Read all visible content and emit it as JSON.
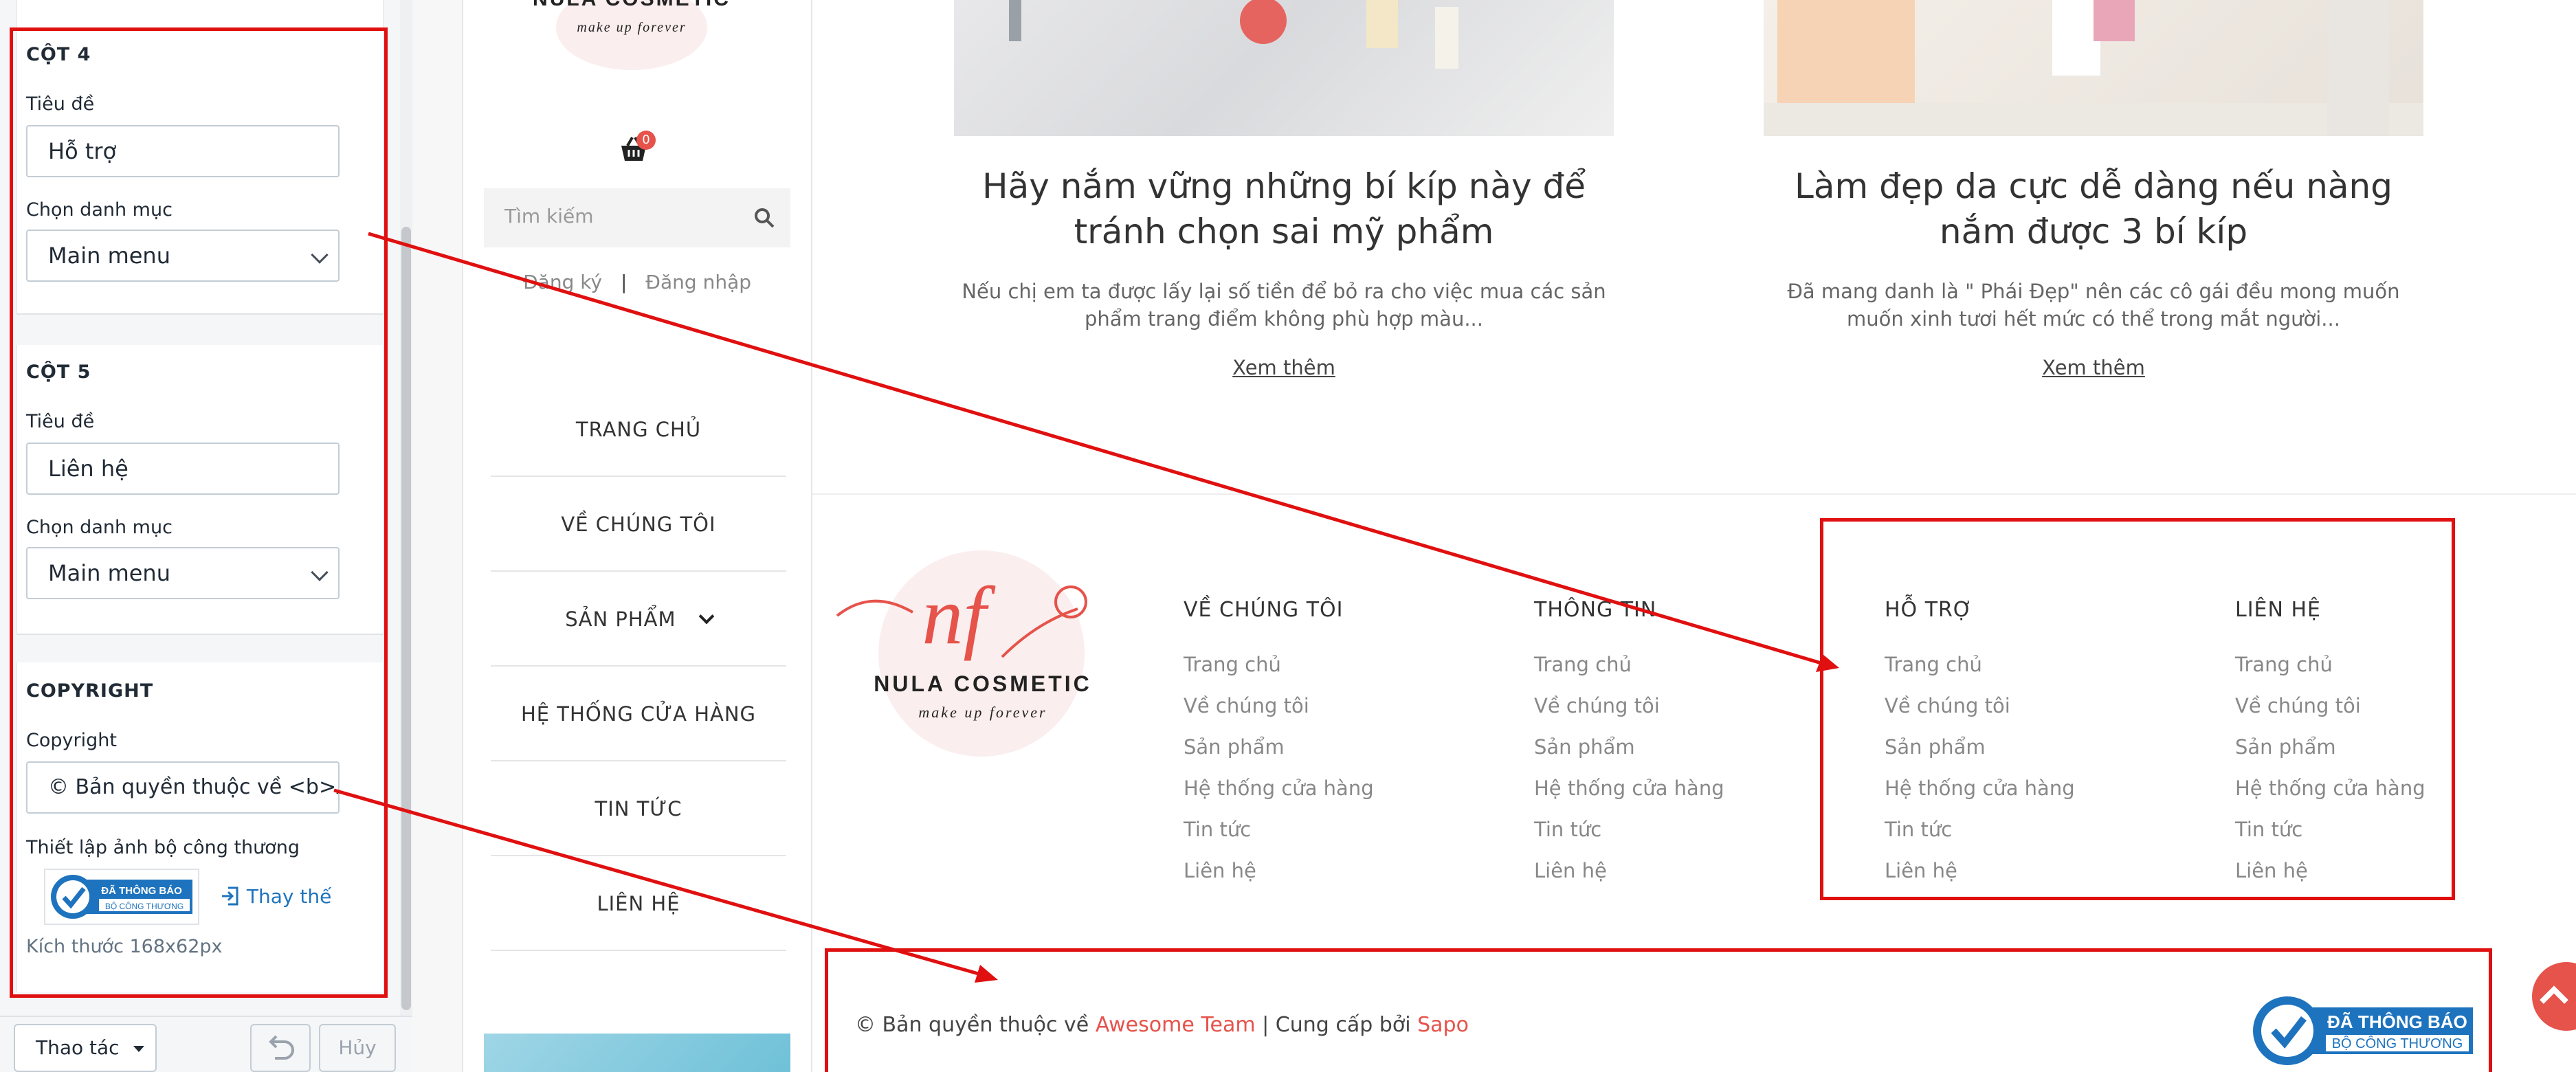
{
  "panel": {
    "col4": {
      "heading": "CỘT 4",
      "title_label": "Tiêu đề",
      "title_value": "Hỗ trợ",
      "category_label": "Chọn danh mục",
      "category_value": "Main menu"
    },
    "col5": {
      "heading": "CỘT 5",
      "title_label": "Tiêu đề",
      "title_value": "Liên hệ",
      "category_label": "Chọn danh mục",
      "category_value": "Main menu"
    },
    "copyright": {
      "heading": "COPYRIGHT",
      "label": "Copyright",
      "value": "© Bản quyền thuộc về <b>Awesome Team</b>",
      "badge_label": "Thiết lập ảnh bộ công thương",
      "replace_label": "Thay thế",
      "size_note": "Kích thước 168x62px"
    },
    "actions_label": "Thao tác",
    "cancel_label": "Hủy"
  },
  "mobile": {
    "brand": "NULA COSMETIC",
    "tagline": "make up forever",
    "cart_count": "0",
    "search_placeholder": "Tìm kiếm",
    "register": "Đăng ký",
    "login": "Đăng nhập",
    "menu": [
      "TRANG CHỦ",
      "VỀ CHÚNG TÔI",
      "SẢN PHẨM",
      "HỆ THỐNG CỬA HÀNG",
      "TIN TỨC",
      "LIÊN HỆ"
    ]
  },
  "articles": [
    {
      "title": "Hãy nắm vững những bí kíp này để tránh chọn sai mỹ phẩm",
      "desc": "Nếu chị em ta được lấy lại số tiền để bỏ ra cho việc mua các sản phẩm trang điểm không phù hợp màu...",
      "more": "Xem thêm"
    },
    {
      "title": "Làm đẹp da cực dễ dàng nếu nàng nắm được 3 bí kíp",
      "desc": "Đã mang danh là \" Phái Đẹp\" nên các cô gái đều mong muốn muốn xinh tươi hết mức có thể trong mắt người...",
      "more": "Xem thêm"
    }
  ],
  "footer": {
    "logo_text": "NULA COSMETIC",
    "logo_tagline": "make up forever",
    "columns": [
      {
        "heading": "VỀ CHÚNG TÔI",
        "links": [
          "Trang chủ",
          "Về chúng tôi",
          "Sản phẩm",
          "Hệ thống cửa hàng",
          "Tin tức",
          "Liên hệ"
        ]
      },
      {
        "heading": "THÔNG TIN",
        "links": [
          "Trang chủ",
          "Về chúng tôi",
          "Sản phẩm",
          "Hệ thống cửa hàng",
          "Tin tức",
          "Liên hệ"
        ]
      },
      {
        "heading": "HỖ TRỢ",
        "links": [
          "Trang chủ",
          "Về chúng tôi",
          "Sản phẩm",
          "Hệ thống cửa hàng",
          "Tin tức",
          "Liên hệ"
        ]
      },
      {
        "heading": "LIÊN HỆ",
        "links": [
          "Trang chủ",
          "Về chúng tôi",
          "Sản phẩm",
          "Hệ thống cửa hàng",
          "Tin tức",
          "Liên hệ"
        ]
      }
    ],
    "copyright_prefix": "© Bản quyền thuộc về",
    "copyright_team": "Awesome Team",
    "copyright_sep": "| Cung cấp bởi",
    "copyright_provider": "Sapo",
    "badge_top": "ĐÃ THÔNG BÁO",
    "badge_bottom": "BỘ CÔNG THƯƠNG"
  },
  "colors": {
    "accent_red": "#e01010",
    "link_red": "#e5534b",
    "badge_blue": "#1e73be",
    "back_to_top": "#e5534b"
  }
}
